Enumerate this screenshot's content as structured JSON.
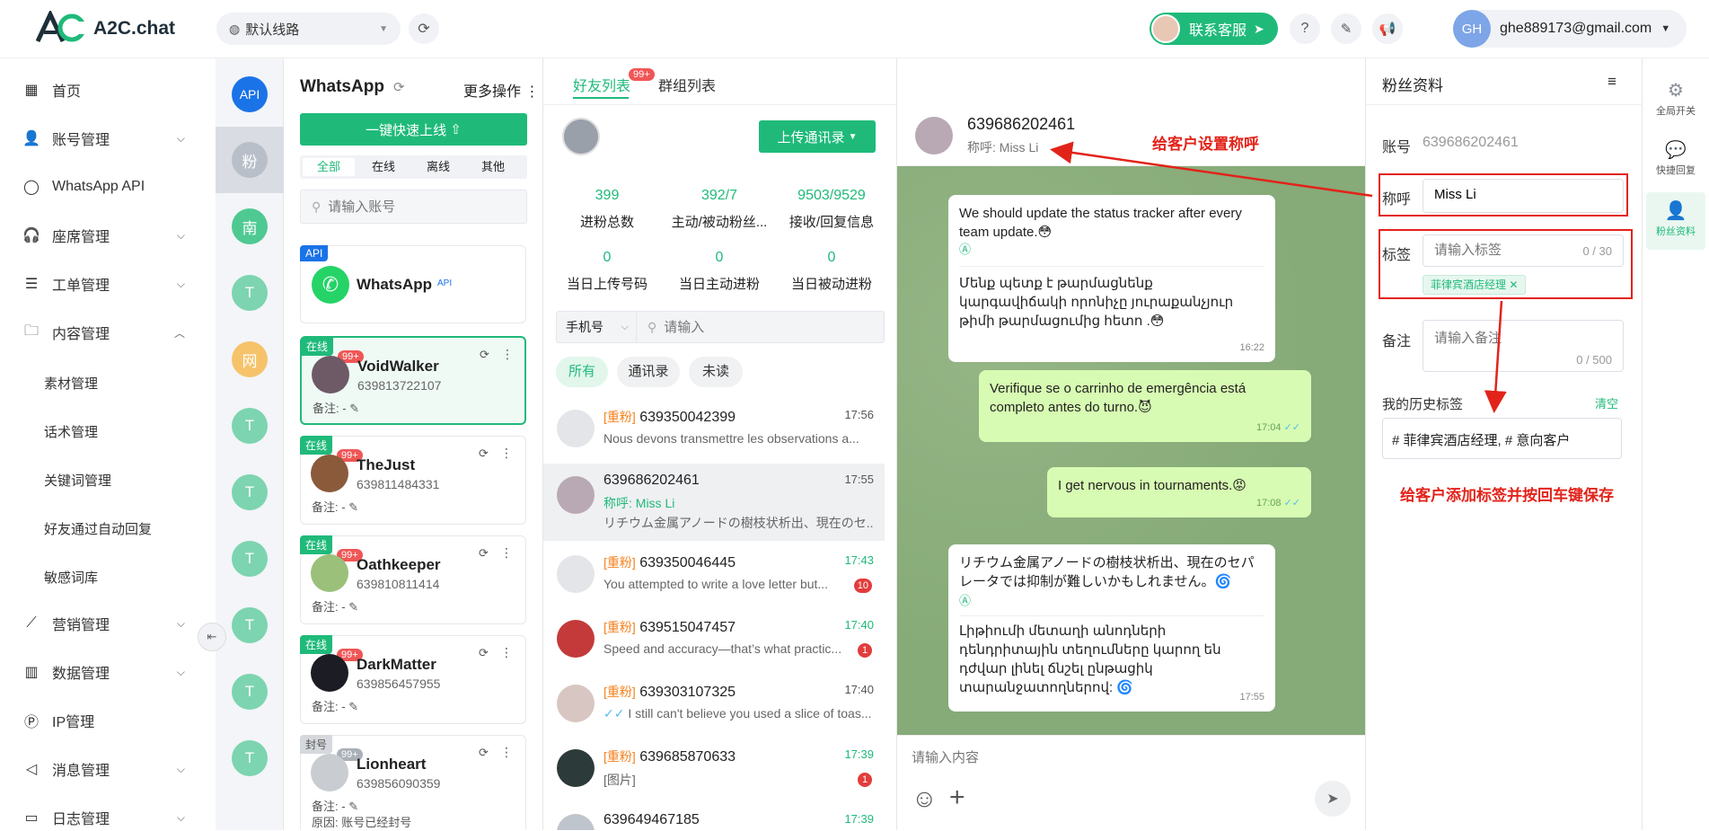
{
  "app": {
    "logo": "A2C.chat",
    "route": "默认线路",
    "support": "联系客服",
    "user_initials": "GH",
    "user_email": "ghe889173@gmail.com"
  },
  "nav": {
    "items": [
      "首页",
      "账号管理",
      "WhatsApp API",
      "座席管理",
      "工单管理",
      "内容管理",
      "营销管理",
      "数据管理",
      "IP管理",
      "消息管理",
      "日志管理"
    ],
    "sub": [
      "素材管理",
      "话术管理",
      "关键词管理",
      "好友通过自动回复",
      "敏感词库"
    ]
  },
  "rail": {
    "items": [
      "API",
      "粉",
      "南",
      "T",
      "网",
      "T",
      "T",
      "T",
      "T",
      "T",
      "T"
    ]
  },
  "accounts": {
    "title": "WhatsApp",
    "more": "更多操作",
    "online_button": "一键快速上线",
    "filters": [
      "全部",
      "在线",
      "离线",
      "其他"
    ],
    "search_placeholder": "请输入账号",
    "api_card": {
      "badge": "API",
      "name": "WhatsApp",
      "sup": "API"
    },
    "cards": [
      {
        "status": "在线",
        "badge": "99+",
        "name": "VoidWalker",
        "phone": "639813722107",
        "note": "备注:  -"
      },
      {
        "status": "在线",
        "badge": "99+",
        "name": "TheJust",
        "phone": "639811484331",
        "note": "备注:  -"
      },
      {
        "status": "在线",
        "badge": "99+",
        "name": "Oathkeeper",
        "phone": "639810811414",
        "note": "备注:  -"
      },
      {
        "status": "在线",
        "badge": "99+",
        "name": "DarkMatter",
        "phone": "639856457955",
        "note": "备注:  -"
      },
      {
        "status": "封号",
        "badge": "99+",
        "name": "Lionheart",
        "phone": "639856090359",
        "note": "备注:  -",
        "reason": "原因:  账号已经封号"
      }
    ]
  },
  "contacts": {
    "tabs": [
      "好友列表",
      "群组列表"
    ],
    "tab_badge": "99+",
    "upload": "上传通讯录",
    "stats": [
      {
        "n": "399",
        "l": "进粉总数"
      },
      {
        "n": "392/7",
        "l": "主动/被动粉丝..."
      },
      {
        "n": "9503/9529",
        "l": "接收/回复信息"
      },
      {
        "n": "0",
        "l": "当日上传号码"
      },
      {
        "n": "0",
        "l": "当日主动进粉"
      },
      {
        "n": "0",
        "l": "当日被动进粉"
      }
    ],
    "search_type": "手机号",
    "search_placeholder": "请输入",
    "chips": [
      "所有",
      "通讯录",
      "未读"
    ],
    "list": [
      {
        "tag": "[重粉]",
        "name": "639350042399",
        "time": "17:56",
        "msg": "Nous devons transmettre les observations a...",
        "unread": ""
      },
      {
        "tag": "",
        "name": "639686202461",
        "time": "17:55",
        "remark": "称呼:  Miss Li",
        "msg": "リチウム金属アノードの樹枝状析出、現在のセ...",
        "unread": ""
      },
      {
        "tag": "[重粉]",
        "name": "639350046445",
        "time": "17:43",
        "msg": "You attempted to write a love letter but...",
        "unread": "10"
      },
      {
        "tag": "[重粉]",
        "name": "639515047457",
        "time": "17:40",
        "msg": "Speed and accuracy—that’s what practic...",
        "unread": "1"
      },
      {
        "tag": "[重粉]",
        "name": "639303107325",
        "time": "17:40",
        "msg": "I still can't believe you used a slice of toas...",
        "unread": ""
      },
      {
        "tag": "[重粉]",
        "name": "639685870633",
        "time": "17:39",
        "msg": "[图片]",
        "unread": "1"
      },
      {
        "tag": "",
        "name": "639649467185",
        "time": "17:39",
        "msg": "",
        "unread": ""
      }
    ]
  },
  "chat": {
    "name": "639686202461",
    "remark": "称呼:  Miss Li",
    "input_placeholder": "请输入内容",
    "messages": [
      {
        "dir": "in",
        "text": "We should update the status tracker after every team update.😳",
        "trans": "Մենք պետք է թարմացնենք կարգավիճակի որոնիչը յուրաքանչյուր թիմի թարմացումից հետո .😳",
        "time": "16:22"
      },
      {
        "dir": "out",
        "text": "Verifique se o carrinho de emergência está completo antes do turno.😈",
        "time": "17:04"
      },
      {
        "dir": "out",
        "text": "I get nervous in tournaments.😡",
        "time": "17:08"
      },
      {
        "dir": "in",
        "text": "リチウム金属アノードの樹枝状析出、現在のセパレータでは抑制が難しいかもしれません。🌀",
        "trans": "Լիթիումի մետաղի անոդների դենդրիտային տեղումները կարող են դժվար լինել ճնշել ընթացիկ տարանջատողներով: 🌀",
        "time": "17:55"
      }
    ]
  },
  "profile": {
    "title": "粉丝资料",
    "account_label": "账号",
    "account": "639686202461",
    "name_label": "称呼",
    "name_value": "Miss Li",
    "tag_label": "标签",
    "tag_placeholder": "请输入标签",
    "tag_count": "0 / 30",
    "tag_chip": "菲律宾酒店经理",
    "note_label": "备注",
    "note_placeholder": "请输入备注",
    "note_count": "0 / 500",
    "history_label": "我的历史标签",
    "clear": "清空",
    "history": "# 菲律宾酒店经理,   # 意向客户"
  },
  "sidetools": [
    "全局开关",
    "快捷回复",
    "粉丝资料"
  ],
  "annotations": {
    "a1": "给客户设置称呼",
    "a2": "给客户添加标签并按回车键保存"
  },
  "colors": {
    "brand": "#1fba7a",
    "red": "#e2231a",
    "chat_bg": "#86aa78",
    "out_bubble": "#d7fbb2"
  }
}
